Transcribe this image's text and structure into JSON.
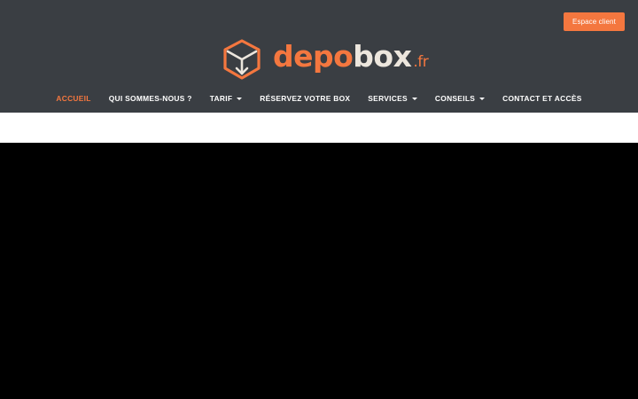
{
  "header": {
    "client_button": "Espace client",
    "logo": {
      "icon": "box-arrow-icon",
      "text_part1": "depo",
      "text_part2": "box",
      "text_tld": ".fr"
    }
  },
  "nav": {
    "items": [
      {
        "label": "ACCUEIL",
        "active": true,
        "dropdown": false
      },
      {
        "label": "QUI SOMMES-NOUS ?",
        "active": false,
        "dropdown": false
      },
      {
        "label": "TARIF",
        "active": false,
        "dropdown": true
      },
      {
        "label": "RÉSERVEZ VOTRE BOX",
        "active": false,
        "dropdown": false
      },
      {
        "label": "SERVICES",
        "active": false,
        "dropdown": true
      },
      {
        "label": "CONSEILS",
        "active": false,
        "dropdown": true
      },
      {
        "label": "CONTACT ET ACCÈS",
        "active": false,
        "dropdown": false
      }
    ]
  },
  "colors": {
    "header_bg": "#3a3e43",
    "accent": "#f4773f",
    "logo_light": "#ece6dd",
    "band": "#ffffff",
    "hero": "#000000"
  }
}
